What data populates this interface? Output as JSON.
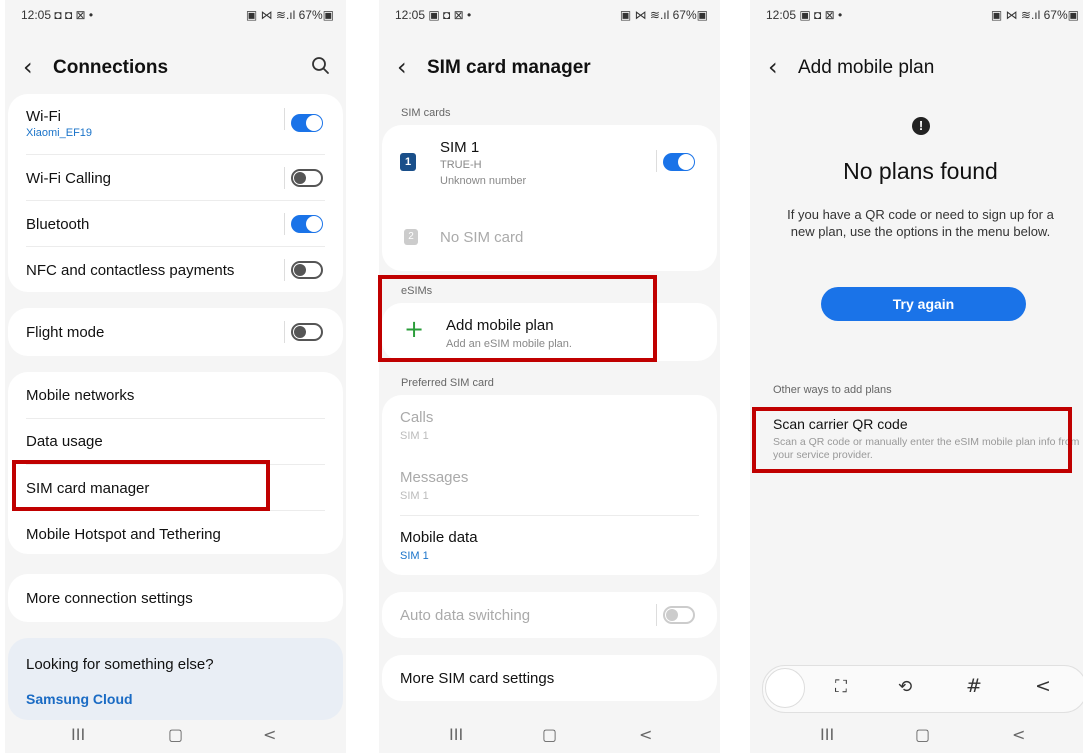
{
  "status": {
    "time": "12:05",
    "left_icons1": "◘ ◘ ⊠ •",
    "left_icons": "▣ ◘ ⊠ •",
    "right": "▣ ⋈ ≋.ıl 67%▣"
  },
  "screen1": {
    "title": "Connections",
    "items": [
      {
        "label": "Wi-Fi",
        "sub": "Xiaomi_EF19",
        "toggle": "on"
      },
      {
        "label": "Wi-Fi Calling",
        "toggle": "off"
      },
      {
        "label": "Bluetooth",
        "toggle": "on"
      },
      {
        "label": "NFC and contactless payments",
        "toggle": "off"
      },
      {
        "label": "Flight mode",
        "toggle": "off"
      },
      {
        "label": "Mobile networks"
      },
      {
        "label": "Data usage"
      },
      {
        "label": "SIM card manager"
      },
      {
        "label": "Mobile Hotspot and Tethering"
      },
      {
        "label": "More connection settings"
      }
    ],
    "looking": "Looking for something else?",
    "samsung_cloud": "Samsung Cloud"
  },
  "screen2": {
    "title": "SIM card manager",
    "sim_cards_header": "SIM cards",
    "sim1": {
      "badge": "1",
      "name": "SIM 1",
      "carrier": "TRUE-H",
      "number": "Unknown number",
      "toggle": "on"
    },
    "sim2": {
      "badge": "2",
      "name": "No SIM card"
    },
    "esims_header": "eSIMs",
    "add_plan": {
      "icon": "+",
      "label": "Add mobile plan",
      "sub": "Add an eSIM mobile plan."
    },
    "preferred_header": "Preferred SIM card",
    "calls": {
      "label": "Calls",
      "sub": "SIM 1"
    },
    "messages": {
      "label": "Messages",
      "sub": "SIM 1"
    },
    "mobile_data": {
      "label": "Mobile data",
      "sub": "SIM 1"
    },
    "auto_data": "Auto data switching",
    "more": "More SIM card settings"
  },
  "screen3": {
    "title": "Add mobile plan",
    "alert_icon": "!",
    "heading": "No plans found",
    "desc": "If you have a QR code or need to sign up for a new plan, use the options in the menu below.",
    "try_again": "Try again",
    "other_header": "Other ways to add plans",
    "scan_label": "Scan carrier QR code",
    "scan_sub": "Scan a QR code or manually enter the eSIM mobile plan info from your service provider.",
    "toolbar": [
      "⛶",
      "⟲",
      "#",
      "<"
    ]
  },
  "nav": {
    "recents": "III",
    "home": "▢",
    "back": "<"
  },
  "colors": {
    "accent": "#1a73e8",
    "highlight": "#c00000"
  }
}
